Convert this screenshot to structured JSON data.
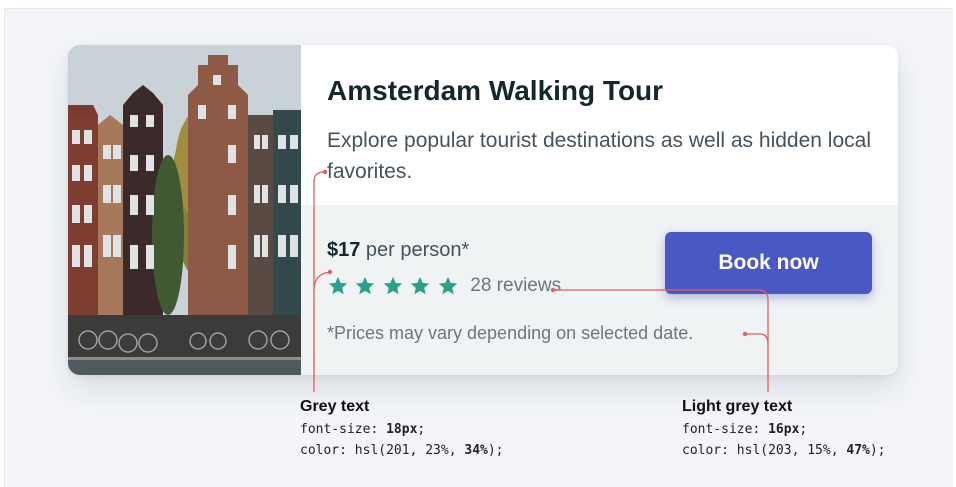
{
  "card": {
    "title": "Amsterdam Walking Tour",
    "description": "Explore popular tourist destinations as well as hidden local favorites.",
    "price_amount": "$17",
    "price_suffix": " per person*",
    "rating_stars": 5,
    "reviews": "28 reviews",
    "disclaimer": "*Prices may vary depending on selected date.",
    "book_label": "Book now"
  },
  "annotations": {
    "grey": {
      "title": "Grey text",
      "fs_label": "font-size: ",
      "fs_value": "18px",
      "color_label": "color: hsl(201, 23%, ",
      "color_value": "34%",
      "color_end": ");"
    },
    "light_grey": {
      "title": "Light grey text",
      "fs_label": "font-size: ",
      "fs_value": "16px",
      "color_label": "color: hsl(203, 15%, ",
      "color_value": "47%",
      "color_end": ");"
    }
  },
  "colors": {
    "accent": "#4a58c4",
    "star": "#2c9f8a",
    "annotation_line": "#e0605a",
    "grey_text": "hsl(201, 23%, 34%)",
    "light_grey_text": "hsl(203, 15%, 47%)"
  },
  "icons": [
    "star-icon"
  ]
}
